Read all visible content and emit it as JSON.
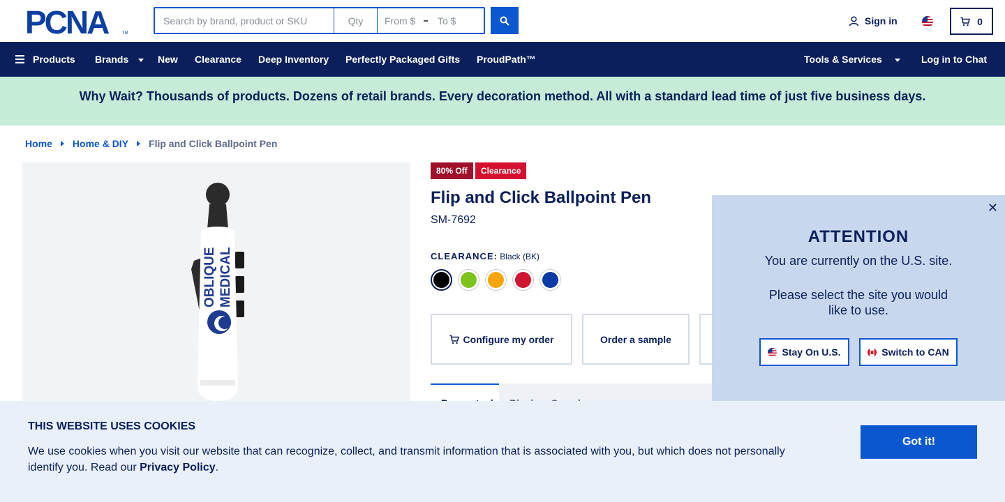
{
  "header": {
    "logo_text": "PCNA",
    "search_placeholder": "Search by brand, product or SKU",
    "qty_placeholder": "Qty",
    "price_from_placeholder": "From $",
    "price_to_placeholder": "To $",
    "sign_in": "Sign in",
    "cart_count": "0"
  },
  "nav": {
    "items": [
      {
        "label": "Products"
      },
      {
        "label": "Brands"
      },
      {
        "label": "New"
      },
      {
        "label": "Clearance"
      },
      {
        "label": "Deep Inventory"
      },
      {
        "label": "Perfectly Packaged Gifts"
      },
      {
        "label": "ProudPath™"
      }
    ],
    "tools": "Tools & Services",
    "chat": "Log in to Chat"
  },
  "promo": {
    "text": "Why Wait? Thousands of products. Dozens of retail brands. Every decoration method. All with a standard lead time of just five business days."
  },
  "breadcrumb": {
    "items": [
      "Home",
      "Home & DIY"
    ],
    "current": "Flip and Click Ballpoint Pen"
  },
  "product": {
    "badges": [
      "80% Off",
      "Clearance"
    ],
    "title": "Flip and Click Ballpoint Pen",
    "sku": "SM-7692",
    "color_label": "CLEARANCE:",
    "color_value": "Black (BK)",
    "swatches": [
      {
        "name": "black",
        "color": "#000000"
      },
      {
        "name": "lime",
        "color": "#7dc21e"
      },
      {
        "name": "orange",
        "color": "#f7a50a"
      },
      {
        "name": "red",
        "color": "#cf1532"
      },
      {
        "name": "blue",
        "color": "#0a3aa5"
      }
    ],
    "imprint_text_1": "OBLIQUE",
    "imprint_text_2": "MEDICAL",
    "actions": {
      "configure": "Configure my order",
      "sample": "Order a sample"
    },
    "tabs": [
      "Powerstock",
      "Blank or Sample"
    ]
  },
  "attention": {
    "title": "ATTENTION",
    "line1": "You are currently on the U.S. site.",
    "line2": "Please select the site you would like to use.",
    "stay_us": "Stay On U.S.",
    "switch_can": "Switch to CAN"
  },
  "cookie": {
    "title": "THIS WEBSITE USES COOKIES",
    "text": "We use cookies when you visit our website that can recognize, collect, and transmit information that is associated with you, but which does not personally identify you. Read our",
    "policy_link": "Privacy Policy",
    "period": ".",
    "button": "Got it!"
  },
  "colors": {
    "navy": "#0a1f5c",
    "brand_blue": "#0b57d0",
    "promo_green": "#c5ecd6",
    "clearance_red": "#d4102e"
  }
}
